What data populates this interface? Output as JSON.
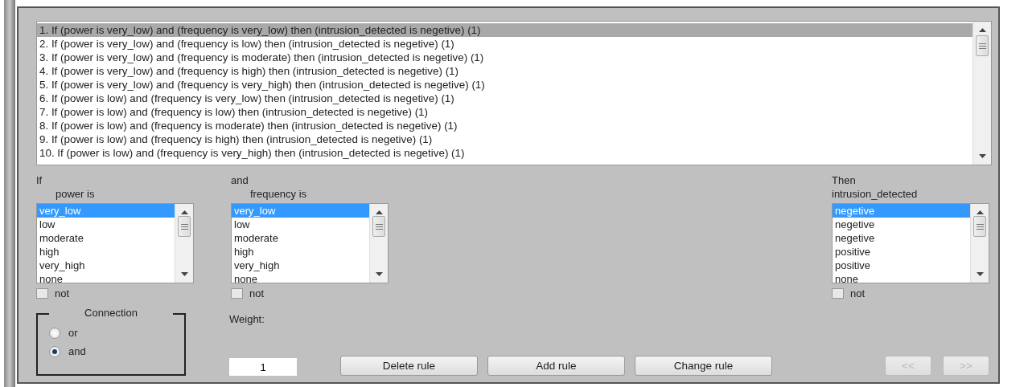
{
  "rules": [
    {
      "text": "1. If (power is very_low) and (frequency is very_low) then (intrusion_detected is negetive) (1)",
      "selected": true
    },
    {
      "text": "2. If (power is very_low) and (frequency is low) then (intrusion_detected is negetive) (1)",
      "selected": false
    },
    {
      "text": "3. If (power is very_low) and (frequency is moderate) then (intrusion_detected is negetive) (1)",
      "selected": false
    },
    {
      "text": "4. If (power is very_low) and (frequency is high) then (intrusion_detected is negetive) (1)",
      "selected": false
    },
    {
      "text": "5. If (power is very_low) and (frequency is very_high) then (intrusion_detected is negetive) (1)",
      "selected": false
    },
    {
      "text": "6. If (power is low) and (frequency is very_low) then (intrusion_detected is negetive) (1)",
      "selected": false
    },
    {
      "text": "7. If (power is low) and (frequency is low) then (intrusion_detected is negetive) (1)",
      "selected": false
    },
    {
      "text": "8. If (power is low) and (frequency is moderate) then (intrusion_detected is negetive) (1)",
      "selected": false
    },
    {
      "text": "9. If (power is low) and (frequency is high) then (intrusion_detected is negetive) (1)",
      "selected": false
    },
    {
      "text": "10. If (power is low) and (frequency is very_high) then (intrusion_detected is negetive) (1)",
      "selected": false
    }
  ],
  "inputs": [
    {
      "caption": "If",
      "variable": "power is",
      "options": [
        {
          "label": "very_low",
          "selected": true
        },
        {
          "label": "low",
          "selected": false
        },
        {
          "label": "moderate",
          "selected": false
        },
        {
          "label": "high",
          "selected": false
        },
        {
          "label": "very_high",
          "selected": false
        },
        {
          "label": "none",
          "selected": false
        }
      ],
      "not": {
        "label": "not",
        "checked": false
      }
    },
    {
      "caption": "and",
      "variable": "frequency is",
      "options": [
        {
          "label": "very_low",
          "selected": true
        },
        {
          "label": "low",
          "selected": false
        },
        {
          "label": "moderate",
          "selected": false
        },
        {
          "label": "high",
          "selected": false
        },
        {
          "label": "very_high",
          "selected": false
        },
        {
          "label": "none",
          "selected": false
        }
      ],
      "not": {
        "label": "not",
        "checked": false
      }
    }
  ],
  "output": {
    "caption": "Then",
    "variable": "intrusion_detected",
    "options": [
      {
        "label": "negetive",
        "selected": true
      },
      {
        "label": "negetive",
        "selected": false
      },
      {
        "label": "negetive",
        "selected": false
      },
      {
        "label": "positive",
        "selected": false
      },
      {
        "label": "positive",
        "selected": false
      },
      {
        "label": "none",
        "selected": false
      }
    ],
    "not": {
      "label": "not",
      "checked": false
    }
  },
  "connection": {
    "title": "Connection",
    "options": [
      {
        "label": "or",
        "selected": false
      },
      {
        "label": "and",
        "selected": true
      }
    ]
  },
  "weight": {
    "label": "Weight:",
    "value": "1"
  },
  "buttons": [
    {
      "label": "Delete rule",
      "disabled": false
    },
    {
      "label": "Add rule",
      "disabled": false
    },
    {
      "label": "Change rule",
      "disabled": false
    }
  ],
  "nav": [
    {
      "label": "<<",
      "disabled": true
    },
    {
      "label": ">>",
      "disabled": true
    }
  ]
}
